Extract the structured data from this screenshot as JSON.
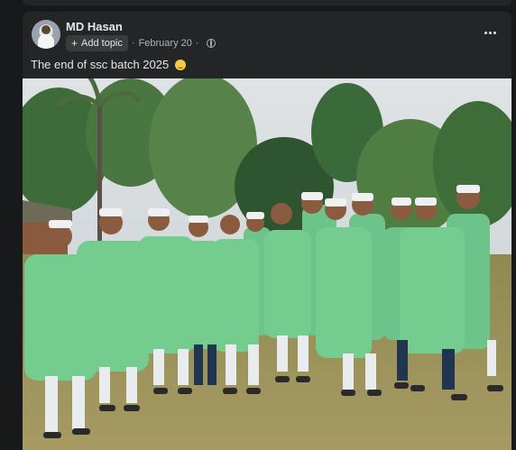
{
  "post": {
    "author": "MD Hasan",
    "add_topic_label": "Add topic",
    "date": "February 20",
    "caption": "The end of ssc batch 2025"
  },
  "icons": {
    "more": "more-options-icon",
    "audience": "globe-icon",
    "emoji": "smiling-face-emoji-icon",
    "add": "plus-icon"
  },
  "colors": {
    "background": "#18191a",
    "card": "#242526",
    "text": "#e4e6eb",
    "secondary_text": "#b0b3b8",
    "kurta_green": "#6cc48a"
  }
}
